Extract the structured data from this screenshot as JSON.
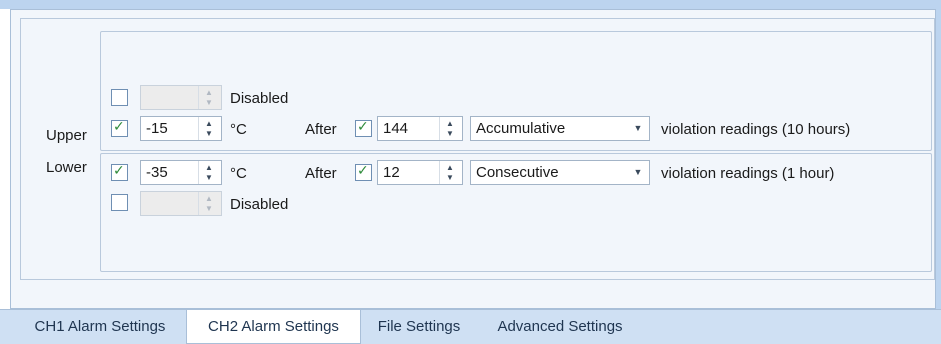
{
  "rows": {
    "upper_label": "Upper",
    "lower_label": "Lower"
  },
  "upper": {
    "disabled_row": {
      "checked": false,
      "value": "",
      "status_label": "Disabled"
    },
    "active_row": {
      "checked": true,
      "value": "-15",
      "unit": "°C",
      "after_label": "After",
      "after_checked": true,
      "after_count": "144",
      "mode": "Accumulative",
      "suffix": "violation readings (10 hours)"
    }
  },
  "lower": {
    "active_row": {
      "checked": true,
      "value": "-35",
      "unit": "°C",
      "after_label": "After",
      "after_checked": true,
      "after_count": "12",
      "mode": "Consecutive",
      "suffix": "violation readings (1 hour)"
    },
    "disabled_row": {
      "checked": false,
      "value": "",
      "status_label": "Disabled"
    }
  },
  "tabs": [
    {
      "label": "CH1 Alarm Settings",
      "active": false
    },
    {
      "label": "CH2 Alarm Settings",
      "active": true
    },
    {
      "label": "File Settings",
      "active": false
    },
    {
      "label": "Advanced Settings",
      "active": false
    }
  ],
  "icons": {
    "check": "✓",
    "spin_up": "▲",
    "spin_down": "▼",
    "dropdown": "▼"
  },
  "colors": {
    "accent": "#2e8b3a",
    "panel_bg": "#f2f6fb",
    "tab_bar": "#cfe0f3"
  }
}
